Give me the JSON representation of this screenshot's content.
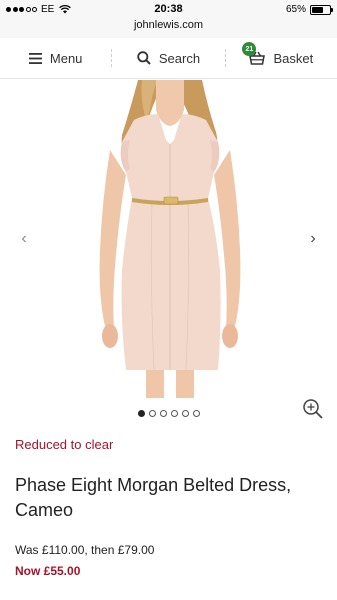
{
  "status_bar": {
    "carrier": "EE",
    "time": "20:38",
    "battery_percent": "65%",
    "battery_level": 0.65,
    "url": "johnlewis.com"
  },
  "nav": {
    "menu_label": "Menu",
    "search_label": "Search",
    "basket_label": "Basket",
    "basket_count": "21"
  },
  "gallery": {
    "prev_arrow": "‹",
    "next_arrow": "›",
    "image_count": 6,
    "active_index": 0
  },
  "product": {
    "promo": "Reduced to clear",
    "title": "Phase Eight Morgan Belted Dress, Cameo",
    "was_price": "Was £110.00, then £79.00",
    "now_price": "Now £55.00"
  },
  "colors": {
    "accent_red": "#a3142b",
    "basket_badge": "#2f8a3a",
    "dress": "#f3d9cc"
  }
}
